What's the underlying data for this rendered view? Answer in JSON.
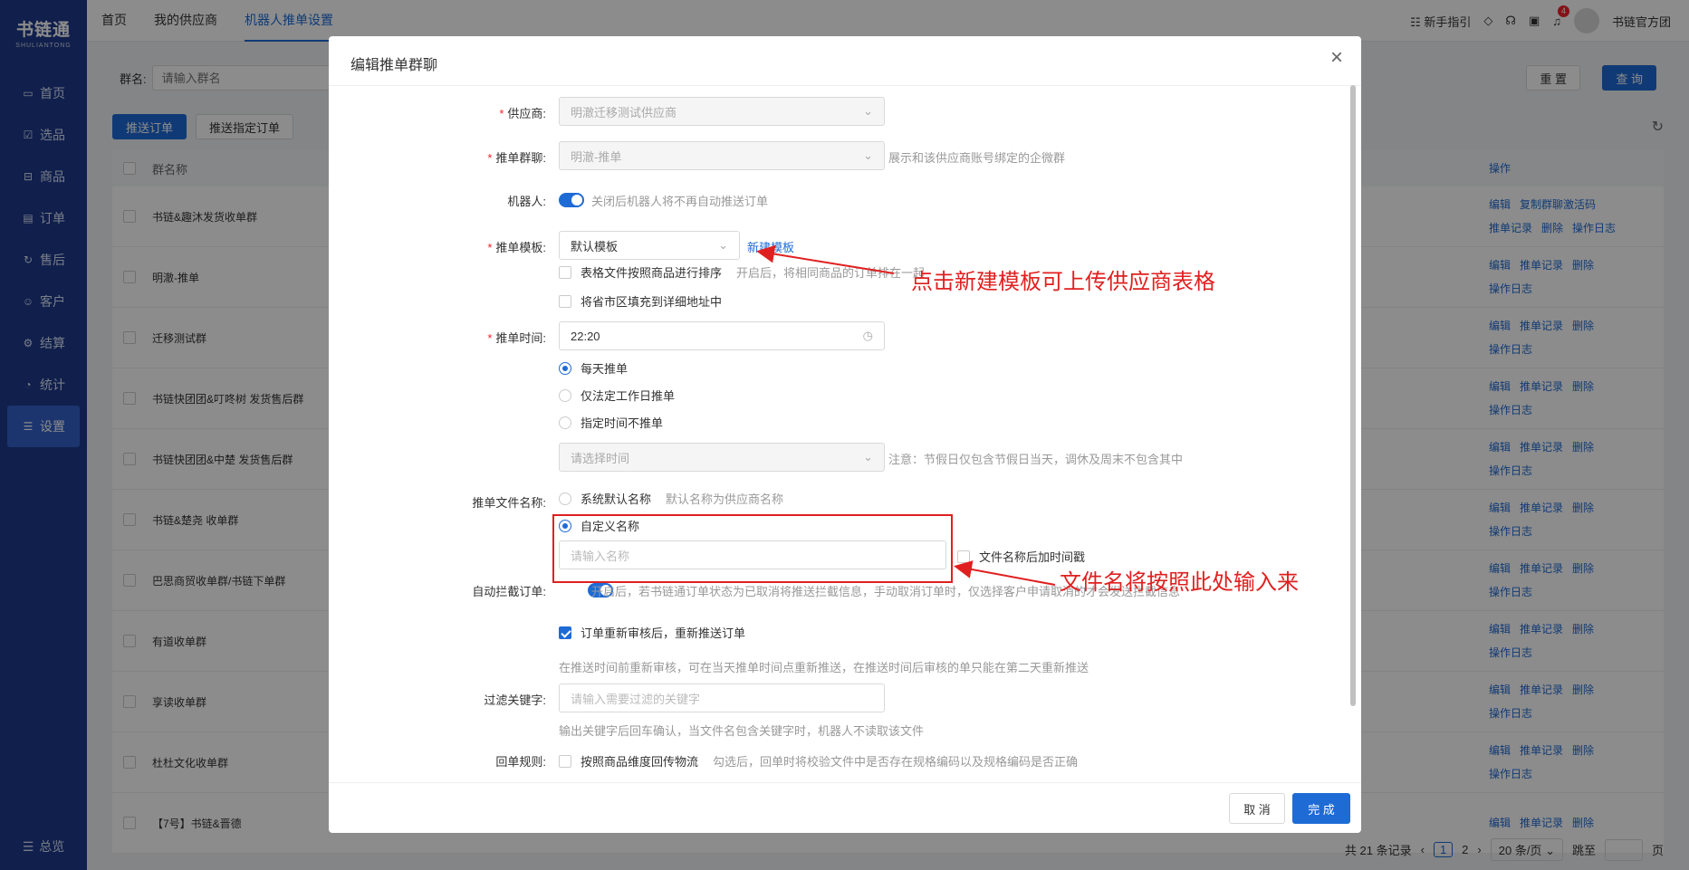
{
  "app": {
    "logo_main": "书链通",
    "logo_sub": "SHULIANTONG",
    "sidebar": [
      {
        "label": "首页",
        "icon": "monitor-icon"
      },
      {
        "label": "选品",
        "icon": "select-icon"
      },
      {
        "label": "商品",
        "icon": "box-icon"
      },
      {
        "label": "订单",
        "icon": "order-icon"
      },
      {
        "label": "售后",
        "icon": "aftersale-icon"
      },
      {
        "label": "客户",
        "icon": "customer-icon"
      },
      {
        "label": "结算",
        "icon": "settle-icon"
      },
      {
        "label": "统计",
        "icon": "chart-icon"
      },
      {
        "label": "设置",
        "icon": "settings-icon"
      }
    ],
    "sidebar_bottom": "总览"
  },
  "topbar": {
    "tabs": [
      "首页",
      "我的供应商",
      "机器人推单设置"
    ],
    "guide": "新手指引",
    "notifications": "4",
    "user": "书链官方团"
  },
  "page": {
    "filter_label": "群名:",
    "filter_placeholder": "请输入群名",
    "reset": "重 置",
    "query": "查 询",
    "btn_push": "推送订单",
    "btn_push_specific": "推送指定订单",
    "col_name": "群名称",
    "col_ops": "操作",
    "rows": [
      {
        "name": "书链&趣沐发货收单群",
        "ops1": [
          "编辑",
          "复制群聊激活码"
        ],
        "ops2": [
          "推单记录",
          "删除",
          "操作日志"
        ]
      },
      {
        "name": "明澈-推单",
        "ops1": [
          "编辑",
          "推单记录",
          "删除"
        ],
        "ops2": [
          "操作日志"
        ]
      },
      {
        "name": "迁移测试群",
        "ops1": [
          "编辑",
          "推单记录",
          "删除"
        ],
        "ops2": [
          "操作日志"
        ]
      },
      {
        "name": "书链快团团&叮咚树 发货售后群",
        "ops1": [
          "编辑",
          "推单记录",
          "删除"
        ],
        "ops2": [
          "操作日志"
        ]
      },
      {
        "name": "书链快团团&中楚 发货售后群",
        "ops1": [
          "编辑",
          "推单记录",
          "删除"
        ],
        "ops2": [
          "操作日志"
        ]
      },
      {
        "name": "书链&楚尧 收单群",
        "ops1": [
          "编辑",
          "推单记录",
          "删除"
        ],
        "ops2": [
          "操作日志"
        ]
      },
      {
        "name": "巴思商贸收单群/书链下单群",
        "ops1": [
          "编辑",
          "推单记录",
          "删除"
        ],
        "ops2": [
          "操作日志"
        ]
      },
      {
        "name": "有道收单群",
        "ops1": [
          "编辑",
          "推单记录",
          "删除"
        ],
        "ops2": [
          "操作日志"
        ]
      },
      {
        "name": "享读收单群",
        "ops1": [
          "编辑",
          "推单记录",
          "删除"
        ],
        "ops2": [
          "操作日志"
        ]
      },
      {
        "name": "杜杜文化收单群",
        "ops1": [
          "编辑",
          "推单记录",
          "删除"
        ],
        "ops2": [
          "操作日志"
        ]
      },
      {
        "name": "【7号】书链&晋德",
        "ops1": [
          "编辑",
          "推单记录",
          "删除"
        ],
        "ops2": []
      }
    ],
    "pager": {
      "total": "共 21 条记录",
      "page1": "1",
      "page2": "2",
      "size": "20 条/页",
      "goto": "跳至",
      "unit": "页"
    }
  },
  "modal": {
    "title": "编辑推单群聊",
    "supplier_label": "供应商:",
    "supplier_value": "明澈迁移测试供应商",
    "group_label": "推单群聊:",
    "group_value": "明澈-推单",
    "group_hint": "展示和该供应商账号绑定的企微群",
    "robot_label": "机器人:",
    "robot_hint": "关闭后机器人将不再自动推送订单",
    "template_label": "推单模板:",
    "template_value": "默认模板",
    "new_template": "新建模板",
    "sort_option": "表格文件按照商品进行排序",
    "sort_hint": "开启后，将相同商品的订单排在一起",
    "fill_option": "将省市区填充到详细地址中",
    "time_label": "推单时间:",
    "time_value": "22:20",
    "daily": "每天推单",
    "workday": "仅法定工作日推单",
    "specified": "指定时间不推单",
    "pick_time_placeholder": "请选择时间",
    "holiday_hint": "注意：节假日仅包含节假日当天，调休及周末不包含其中",
    "filename_label": "推单文件名称:",
    "default_name": "系统默认名称",
    "default_name_hint": "默认名称为供应商名称",
    "custom_name": "自定义名称",
    "name_placeholder": "请输入名称",
    "timestamp_option": "文件名称后加时间戳",
    "intercept_label": "自动拦截订单:",
    "intercept_hint": "开启后，若书链通订单状态为已取消将推送拦截信息，手动取消订单时，仅选择客户申请取消的才会发送拦截信息",
    "recheck_option": "订单重新审核后，重新推送订单",
    "recheck_hint": "在推送时间前重新审核，可在当天推单时间点重新推送，在推送时间后审核的单只能在第二天重新推送",
    "keyword_label": "过滤关键字:",
    "keyword_placeholder": "请输入需要过滤的关键字",
    "keyword_hint": "输出关键字后回车确认，当文件名包含关键字时，机器人不读取该文件",
    "return_label": "回单规则:",
    "return_option": "按照商品维度回传物流",
    "return_hint": "勾选后，回单时将校验文件中是否存在规格编码以及规格编码是否正确",
    "cancel": "取 消",
    "ok": "完 成"
  },
  "annotations": {
    "template_note": "点击新建模板可上传供应商表格",
    "filename_note": "文件名将按照此处输入来",
    "color": "#e02020"
  }
}
